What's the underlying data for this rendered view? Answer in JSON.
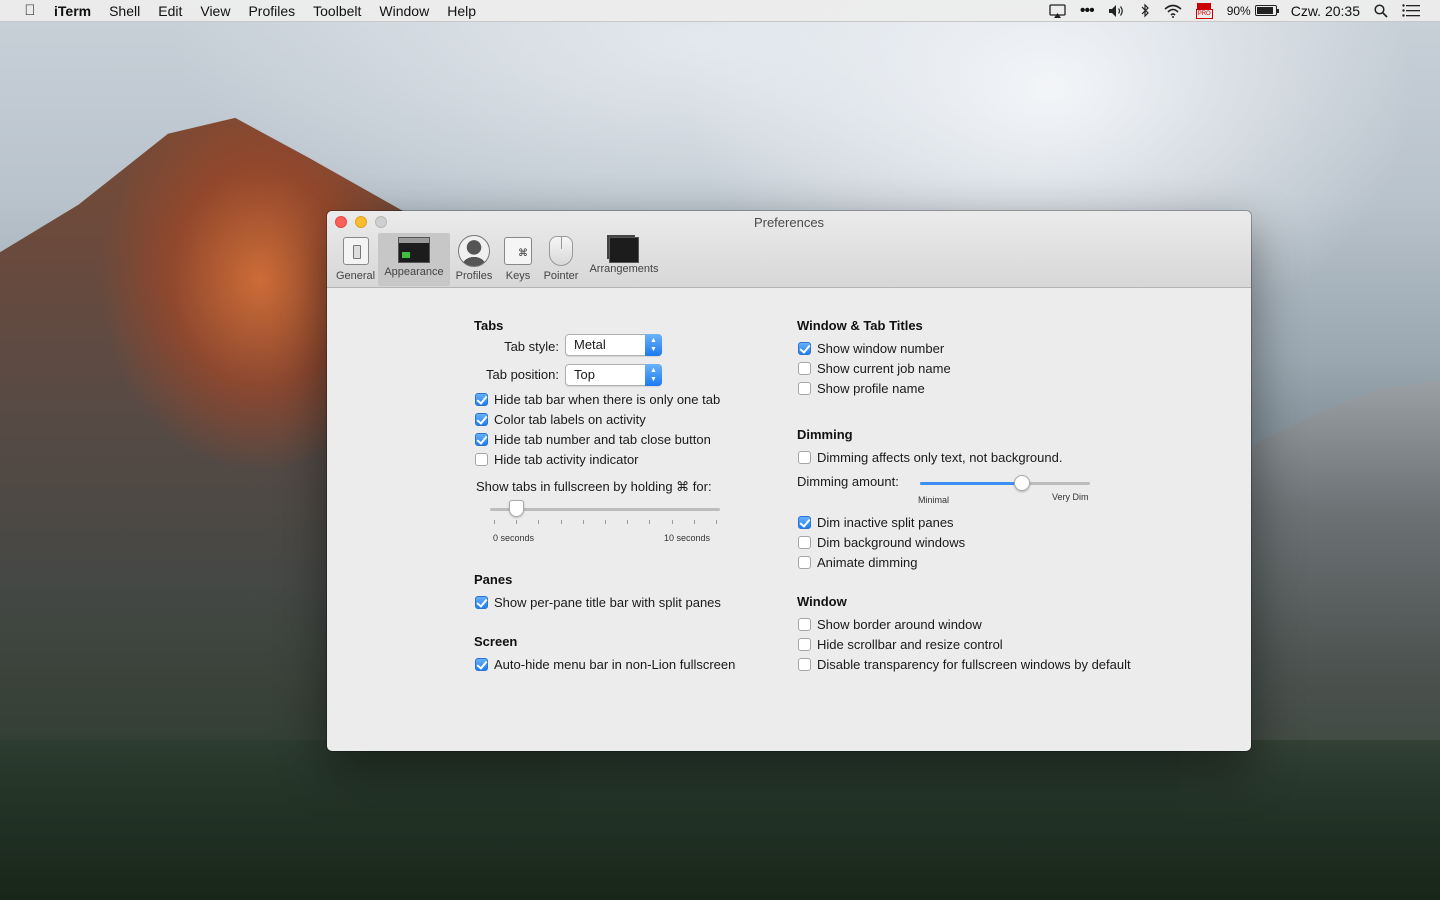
{
  "menubar": {
    "app_name": "iTerm",
    "items": [
      "Shell",
      "Edit",
      "View",
      "Profiles",
      "Toolbelt",
      "Window",
      "Help"
    ],
    "battery_percent": "90%",
    "battery_level": 0.9,
    "clock": "Czw. 20:35"
  },
  "window": {
    "title": "Preferences",
    "toolbar": [
      {
        "label": "General",
        "icon": "general-switch-icon",
        "selected": false
      },
      {
        "label": "Appearance",
        "icon": "appearance-window-icon",
        "selected": true
      },
      {
        "label": "Profiles",
        "icon": "profile-user-icon",
        "selected": false
      },
      {
        "label": "Keys",
        "icon": "keys-command-icon",
        "selected": false
      },
      {
        "label": "Pointer",
        "icon": "mouse-pointer-icon",
        "selected": false
      },
      {
        "label": "Arrangements",
        "icon": "arrangements-windows-icon",
        "selected": false
      }
    ]
  },
  "tabs": {
    "title": "Tabs",
    "tab_style_label": "Tab style:",
    "tab_style_value": "Metal",
    "tab_position_label": "Tab position:",
    "tab_position_value": "Top",
    "options": [
      {
        "label": "Hide tab bar when there is only one tab",
        "checked": true
      },
      {
        "label": "Color tab labels on activity",
        "checked": true
      },
      {
        "label": "Hide tab number and tab close button",
        "checked": true
      },
      {
        "label": "Hide tab activity indicator",
        "checked": false
      }
    ],
    "fullscreen_label": "Show tabs in fullscreen by holding ⌘ for:",
    "fullscreen_min": "0 seconds",
    "fullscreen_max": "10 seconds",
    "fullscreen_value": 1
  },
  "panes": {
    "title": "Panes",
    "options": [
      {
        "label": "Show per-pane title bar with split panes",
        "checked": true
      }
    ]
  },
  "screen": {
    "title": "Screen",
    "options": [
      {
        "label": "Auto-hide menu bar in non-Lion fullscreen",
        "checked": true
      }
    ]
  },
  "window_titles": {
    "title": "Window & Tab Titles",
    "options": [
      {
        "label": "Show window number",
        "checked": true
      },
      {
        "label": "Show current job name",
        "checked": false
      },
      {
        "label": "Show profile name",
        "checked": false
      }
    ]
  },
  "dimming": {
    "title": "Dimming",
    "text_only": {
      "label": "Dimming affects only text, not background.",
      "checked": false
    },
    "amount_label": "Dimming amount:",
    "min_label": "Minimal",
    "max_label": "Very Dim",
    "amount_value": 0.6,
    "options": [
      {
        "label": "Dim inactive split panes",
        "checked": true
      },
      {
        "label": "Dim background windows",
        "checked": false
      },
      {
        "label": "Animate dimming",
        "checked": false
      }
    ]
  },
  "window_section": {
    "title": "Window",
    "options": [
      {
        "label": "Show border around window",
        "checked": false
      },
      {
        "label": "Hide scrollbar and resize control",
        "checked": false
      },
      {
        "label": "Disable transparency for fullscreen windows by default",
        "checked": false
      }
    ]
  },
  "colors": {
    "accent": "#1f7ff0",
    "close": "#fc5f57",
    "minimize": "#fdbc2e"
  }
}
